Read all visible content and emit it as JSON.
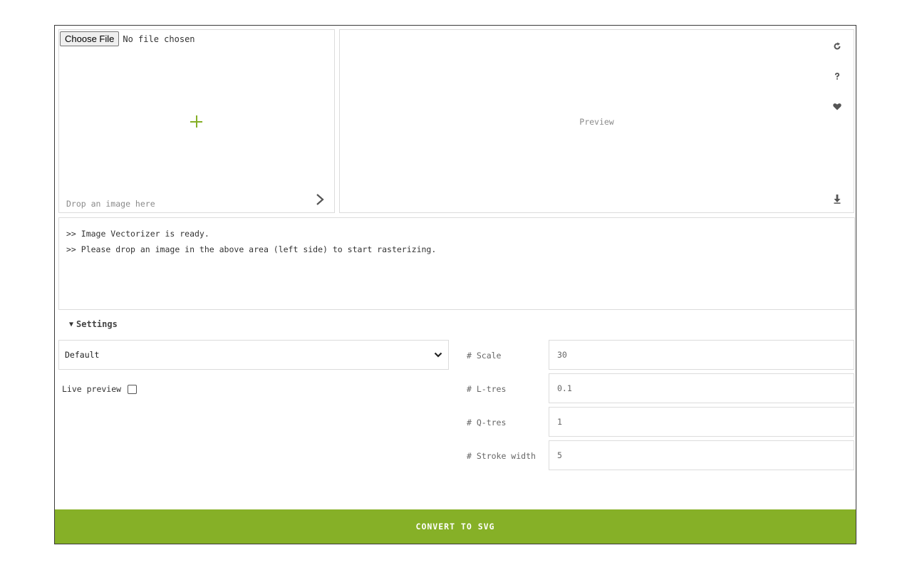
{
  "upload": {
    "choose_file_label": "Choose File",
    "file_status": "No file chosen",
    "drop_hint": "Drop an image here"
  },
  "preview": {
    "label": "Preview",
    "icons": [
      "refresh-icon",
      "help-icon",
      "heart-icon",
      "download-icon"
    ]
  },
  "log": {
    "lines": [
      ">> Image Vectorizer is ready.",
      ">> Please drop an image in the above area (left side) to start rasterizing."
    ]
  },
  "settings": {
    "toggle_symbol": "▼",
    "title": "Settings",
    "preset_value": "Default",
    "live_preview_label": "Live preview",
    "live_preview_checked": false,
    "params": [
      {
        "label": "# Scale",
        "value": "30"
      },
      {
        "label": "# L-tres",
        "value": "0.1"
      },
      {
        "label": "# Q-tres",
        "value": "1"
      },
      {
        "label": "# Stroke width",
        "value": "5"
      }
    ]
  },
  "convert_label": "CONVERT TO SVG",
  "colors": {
    "accent": "#86b027",
    "border": "#dcdcdc"
  }
}
